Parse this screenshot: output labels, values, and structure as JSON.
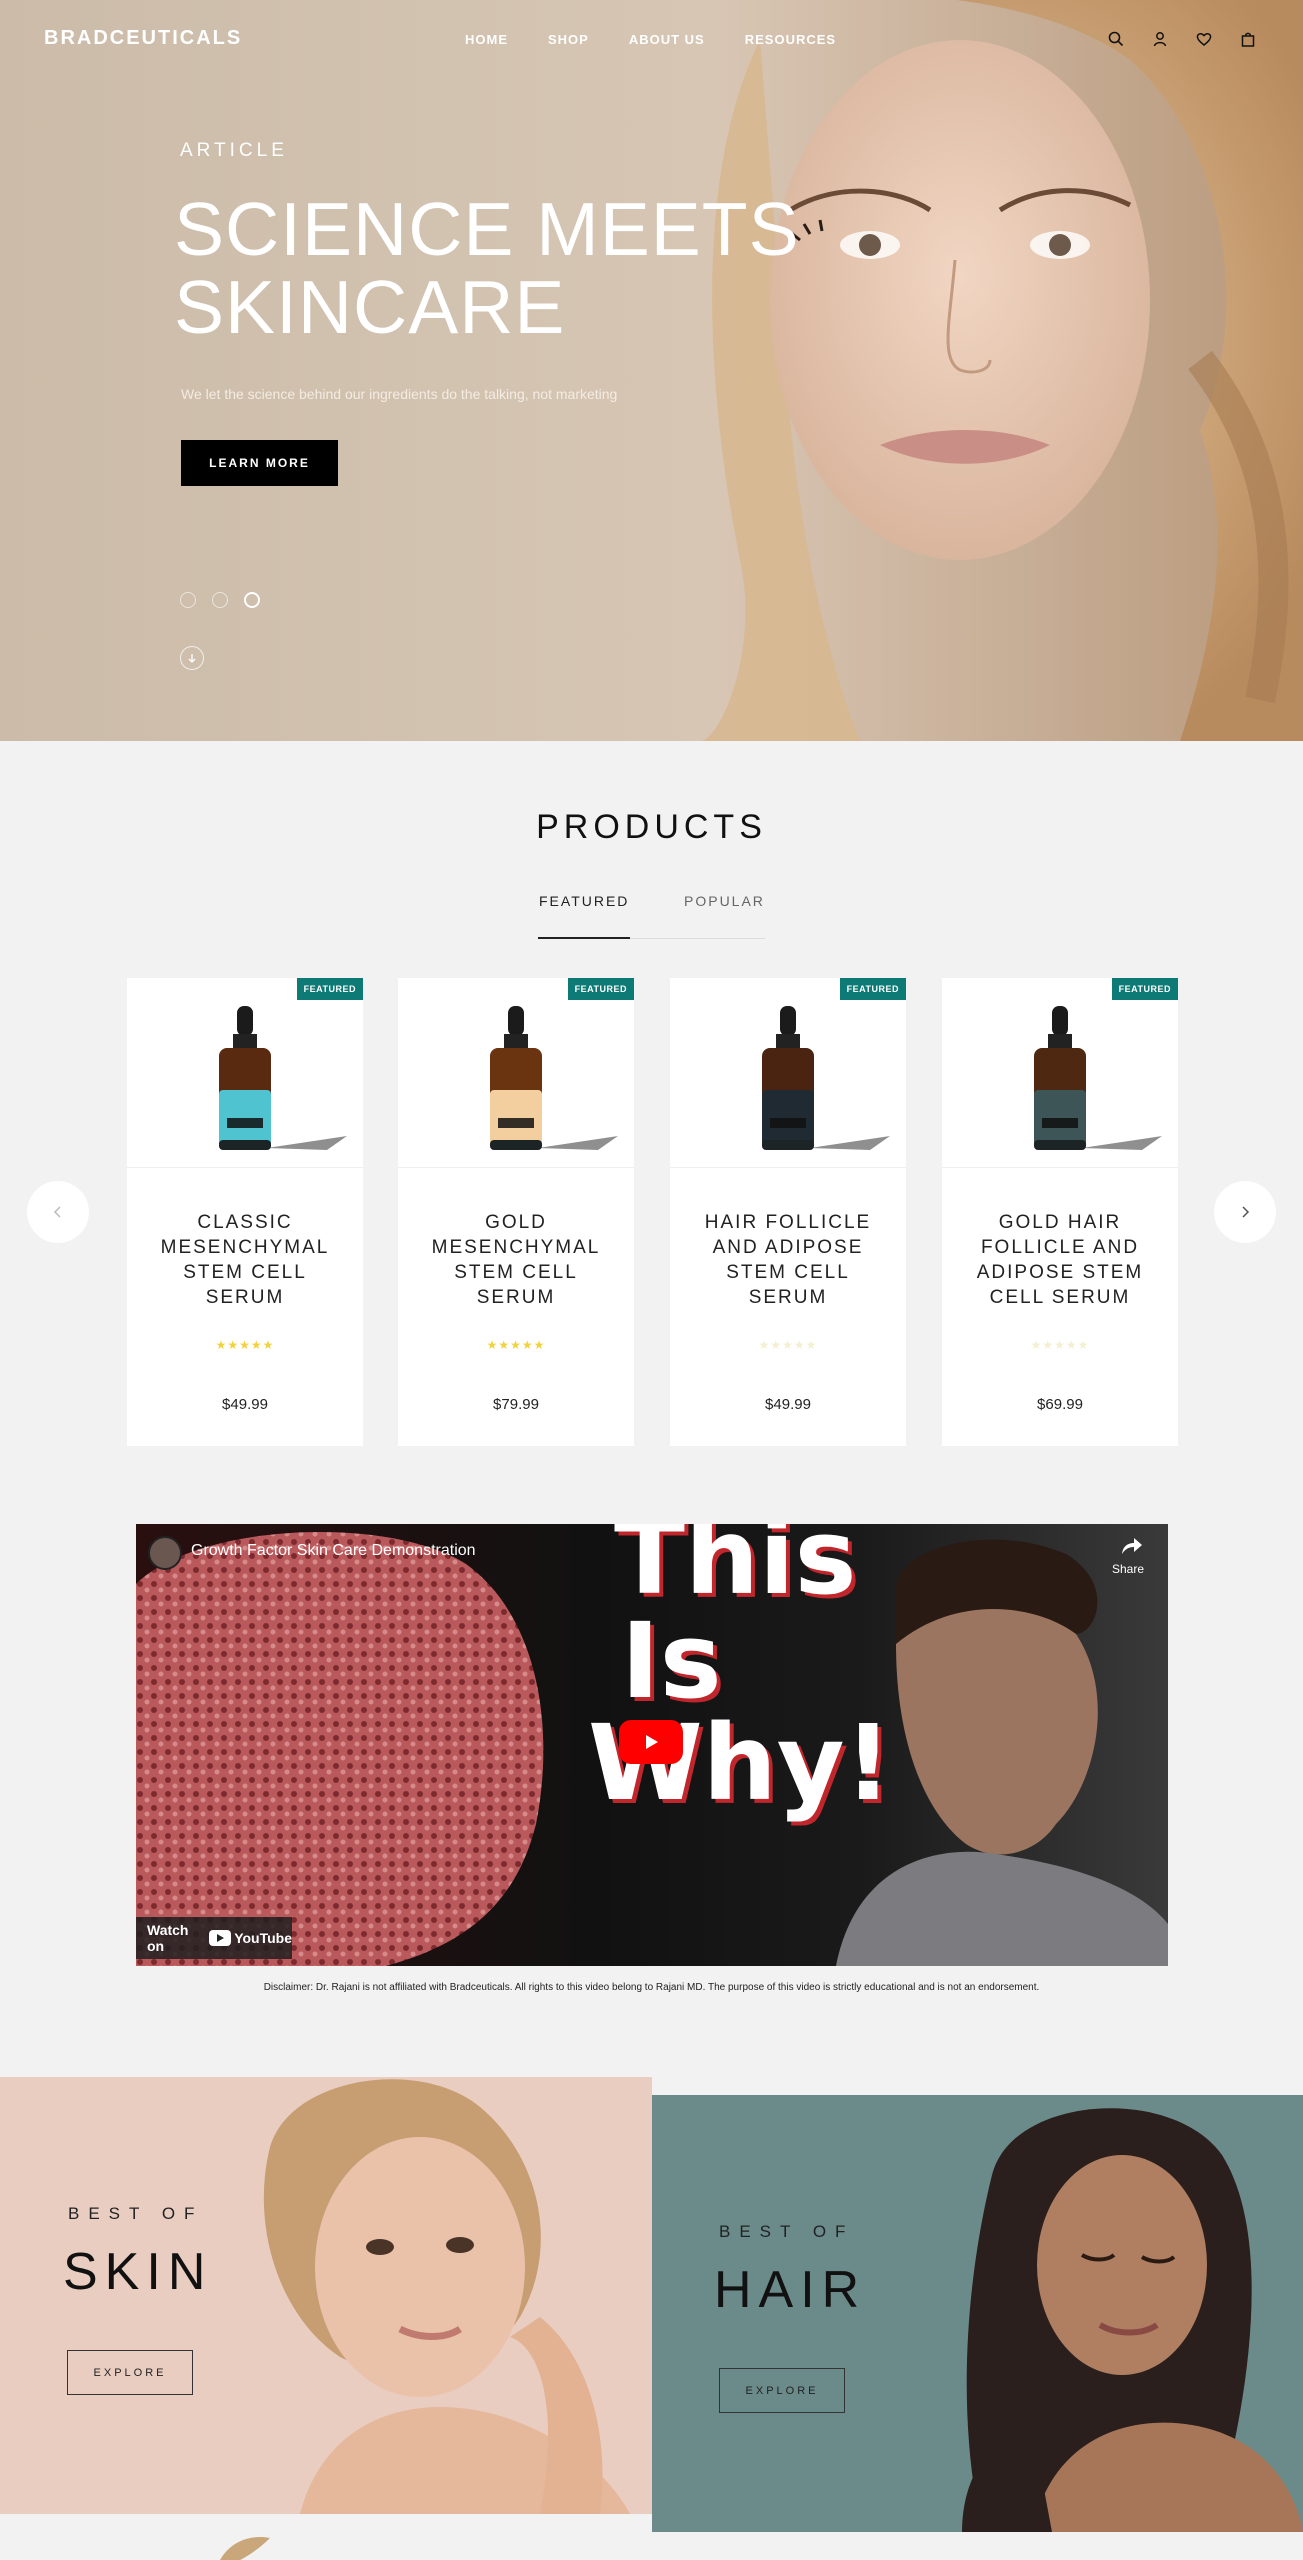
{
  "brand": "BRADCEUTICALS",
  "nav": {
    "links": [
      "HOME",
      "SHOP",
      "ABOUT US",
      "RESOURCES"
    ],
    "icons": [
      "search-icon",
      "user-icon",
      "heart-icon",
      "bag-icon"
    ]
  },
  "hero": {
    "eyebrow": "ARTICLE",
    "title_line1": "SCIENCE MEETS",
    "title_line2": "SKINCARE",
    "subtitle": "We let the science behind our ingredients do the talking, not marketing",
    "button": "LEARN MORE",
    "slides_count": 3,
    "active_slide": 3
  },
  "products": {
    "title": "PRODUCTS",
    "tabs": [
      "FEATURED",
      "POPULAR"
    ],
    "active_tab": "FEATURED",
    "items": [
      {
        "badge": "FEATURED",
        "name": "CLASSIC MESENCHYMAL STEM CELL SERUM",
        "price": "$49.99",
        "rating": 5,
        "label_color": "#4fc3cf",
        "liquid_color": "#5a2a10"
      },
      {
        "badge": "FEATURED",
        "name": "GOLD MESENCHYMAL STEM CELL SERUM",
        "price": "$79.99",
        "rating": 5,
        "label_color": "#f3cfa0",
        "liquid_color": "#6a3410"
      },
      {
        "badge": "FEATURED",
        "name": "HAIR FOLLICLE AND ADIPOSE STEM CELL SERUM",
        "price": "$49.99",
        "rating": 0,
        "label_color": "#1f2a33",
        "liquid_color": "#4a2410"
      },
      {
        "badge": "FEATURED",
        "name": "GOLD HAIR FOLLICLE AND ADIPOSE STEM CELL SERUM",
        "price": "$69.99",
        "rating": 0,
        "label_color": "#3d5556",
        "liquid_color": "#4f2812"
      }
    ]
  },
  "video": {
    "title": "Growth Factor Skin Care Demonstration",
    "share_label": "Share",
    "overlay_line1": "This",
    "overlay_line2": "Is",
    "overlay_line3": "Why!",
    "watch_on": "Watch on",
    "platform": "YouTube"
  },
  "disclaimer": "Disclaimer: Dr. Rajani is not affiliated with Bradceuticals. All rights to this video belong to Rajani MD. The purpose of this video is strictly educational and is not an endorsement.",
  "promos": {
    "skin": {
      "eyebrow": "BEST OF",
      "title": "SKIN",
      "button": "EXPLORE"
    },
    "hair": {
      "eyebrow": "BEST OF",
      "title": "HAIR",
      "button": "EXPLORE"
    }
  },
  "colors": {
    "accent": "#0d7a75",
    "star": "#f2d23c",
    "star_empty": "#f4efcf",
    "hair_panel": "#6b8b8a",
    "skin_panel": "#e9cdc1"
  }
}
